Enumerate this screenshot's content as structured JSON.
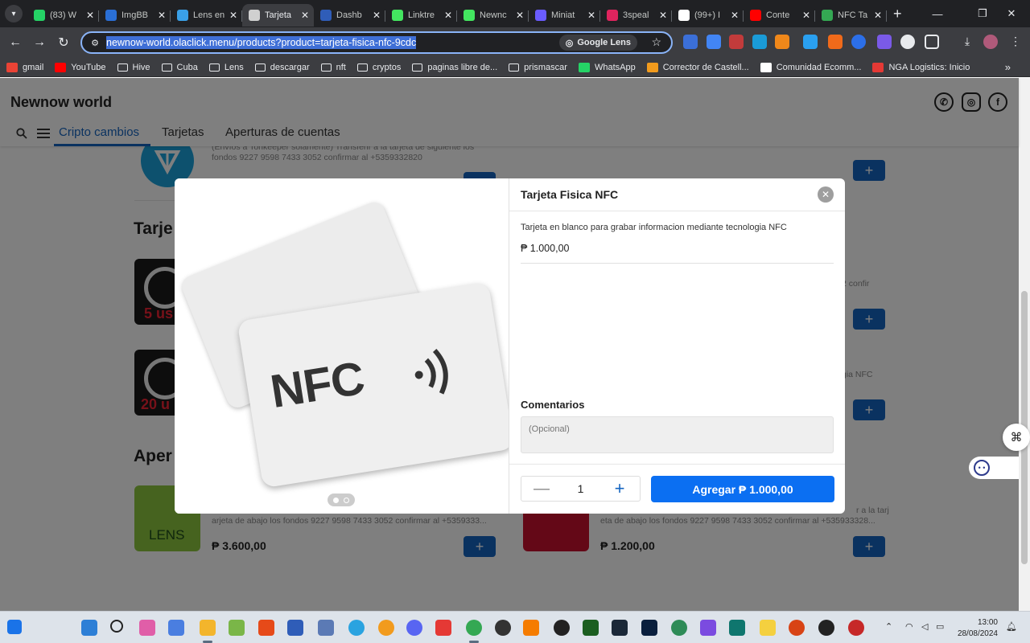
{
  "browser": {
    "tabs": [
      {
        "title": "(83) W",
        "icon": "whatsapp-icon",
        "color": "#25d366"
      },
      {
        "title": "ImgBB",
        "icon": "imgbb-icon",
        "color": "#2a6fd6"
      },
      {
        "title": "Lens en",
        "icon": "lens-icon",
        "color": "#3aa0e8"
      },
      {
        "title": "Tarjeta",
        "icon": "tarjeta-icon",
        "color": "#d0d0d0"
      },
      {
        "title": "Dashb",
        "icon": "dashboard-icon",
        "color": "#2f5db8"
      },
      {
        "title": "Linktre",
        "icon": "linktree-icon",
        "color": "#43e660"
      },
      {
        "title": "Newnc",
        "icon": "newnow-icon",
        "color": "#43e660"
      },
      {
        "title": "Miniat",
        "icon": "heart-icon",
        "color": "#6a5cff"
      },
      {
        "title": "3speal",
        "icon": "3speak-icon",
        "color": "#e0245e"
      },
      {
        "title": "(99+) I",
        "icon": "mail-icon",
        "color": "#ffffff"
      },
      {
        "title": "Conte",
        "icon": "youtube-icon",
        "color": "#ff0000"
      },
      {
        "title": "NFC Ta",
        "icon": "play-store-icon",
        "color": "#34a853"
      }
    ],
    "active_tab_index": 3,
    "url": "newnow-world.olaclick.menu/products?product=tarjeta-fisica-nfc-9cdc",
    "lens_label": "Google Lens",
    "bookmarks": [
      {
        "label": "gmail",
        "icon": "gmail-icon",
        "color": "#ea4335"
      },
      {
        "label": "YouTube",
        "icon": "youtube-icon",
        "color": "#ff0000"
      },
      {
        "label": "Hive",
        "icon": "folder-icon"
      },
      {
        "label": "Cuba",
        "icon": "folder-icon"
      },
      {
        "label": "Lens",
        "icon": "folder-icon"
      },
      {
        "label": "descargar",
        "icon": "folder-icon"
      },
      {
        "label": "nft",
        "icon": "folder-icon"
      },
      {
        "label": "cryptos",
        "icon": "folder-icon"
      },
      {
        "label": "paginas libre de...",
        "icon": "folder-icon"
      },
      {
        "label": "prismascar",
        "icon": "folder-icon"
      },
      {
        "label": "WhatsApp",
        "icon": "whatsapp-icon",
        "color": "#25d366"
      },
      {
        "label": "Corrector de Castell...",
        "icon": "check-icon",
        "color": "#f29b1d"
      },
      {
        "label": "Comunidad Ecomm...",
        "icon": "sk-icon",
        "color": "#ffffff"
      },
      {
        "label": "NGA Logistics: Inicio",
        "icon": "nga-icon",
        "color": "#e53935"
      }
    ]
  },
  "site": {
    "brand": "Newnow world",
    "nav": [
      "Cripto cambios",
      "Tarjetas",
      "Aperturas de cuentas"
    ],
    "bg_products": {
      "crypto_desc_1": "(Envíos a Tonkeeper solamente) Transferir a la tarjeta de siguiente los",
      "crypto_desc_2": "fondos 9227 9598 7433 3052 confirmar al +5359332820",
      "section_tarjetas": "Tarje",
      "steam_5_badge": "5 us",
      "steam_20_badge": "20 u",
      "right_desc_1": "2 confir",
      "right_desc_2": "gia NFC",
      "section_aperturas": "Aper",
      "lens_logo": "LENS",
      "lens_desc_1": "arjeta de abajo los fondos 9227 9598 7433 3052 confirmar al +5359333...",
      "lens_price": "₱ 3.600,00",
      "right_bottom_desc_0": "r a la tarj",
      "right_bottom_desc_1": "eta de abajo los fondos 9227 9598 7433 3052 confirmar al +535933328...",
      "right_bottom_price": "₱ 1.200,00"
    }
  },
  "modal": {
    "title": "Tarjeta Fisica NFC",
    "description": "Tarjeta en blanco para grabar informacion mediante tecnologia NFC",
    "price": "₱ 1.000,00",
    "image_label": "NFC",
    "comments_label": "Comentarios",
    "comments_placeholder": "(Opcional)",
    "quantity": "1",
    "add_button": "Agregar ₱ 1.000,00"
  },
  "taskbar": {
    "time": "13:00",
    "date": "28/08/2024"
  },
  "colors": {
    "accent": "#1565c0",
    "add_cart": "#0b6ff2",
    "chrome_dark": "#202124",
    "chrome_mid": "#3c3d41"
  }
}
